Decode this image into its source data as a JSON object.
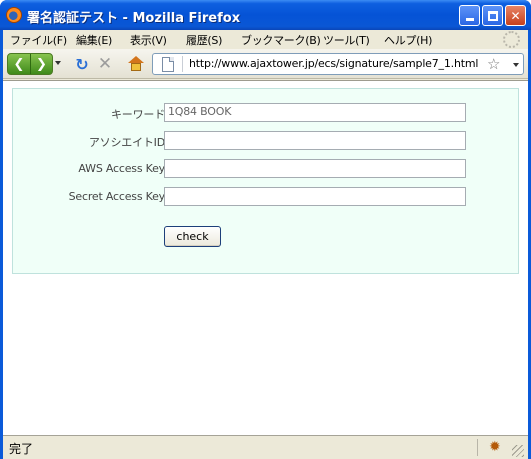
{
  "window": {
    "title": "署名認証テスト - Mozilla Firefox",
    "accent": "#0a5ad9"
  },
  "menubar": {
    "items": [
      "ファイル(F)",
      "編集(E)",
      "表示(V)",
      "履歴(S)",
      "ブックマーク(B)",
      "ツール(T)",
      "ヘルプ(H)"
    ]
  },
  "navbar": {
    "url": "http://www.ajaxtower.jp/ecs/signature/sample7_1.html",
    "icons": [
      "back-icon",
      "forward-icon",
      "reload-icon",
      "stop-icon",
      "home-icon",
      "page-icon",
      "bookmark-star-icon"
    ]
  },
  "form": {
    "keyword_label": "キーワード",
    "keyword_value": "1Q84 BOOK",
    "associate_label": "アソシエイトID",
    "associate_value": "",
    "access_key_label": "AWS Access Key",
    "access_key_value": "",
    "secret_key_label": "Secret Access Key",
    "secret_key_value": "",
    "check_label": "check",
    "panel_color": "#f0fff8"
  },
  "status": {
    "text": "完了"
  }
}
